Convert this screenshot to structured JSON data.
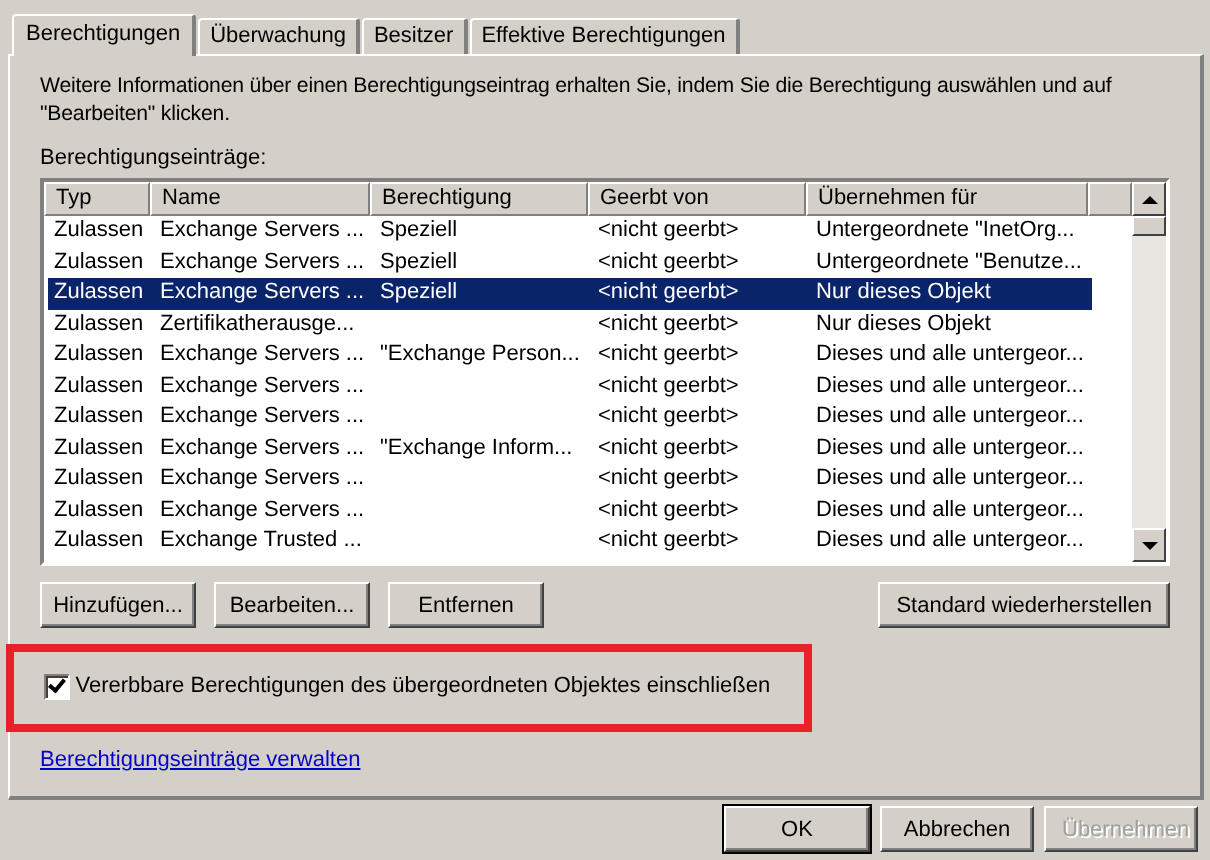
{
  "tabs": [
    {
      "label": "Berechtigungen",
      "selected": true
    },
    {
      "label": "Überwachung",
      "selected": false
    },
    {
      "label": "Besitzer",
      "selected": false
    },
    {
      "label": "Effektive Berechtigungen",
      "selected": false
    }
  ],
  "info_text": "Weitere Informationen über einen Berechtigungseintrag erhalten Sie, indem Sie die Berechtigung auswählen und auf \"Bearbeiten\" klicken.",
  "list_label": "Berechtigungseinträge:",
  "table": {
    "columns": [
      "Typ",
      "Name",
      "Berechtigung",
      "Geerbt von",
      "Übernehmen für"
    ],
    "rows": [
      {
        "cells": [
          "Zulassen",
          "Exchange Servers ...",
          "Speziell",
          "<nicht geerbt>",
          "Untergeordnete \"InetOrg..."
        ],
        "selected": false
      },
      {
        "cells": [
          "Zulassen",
          "Exchange Servers ...",
          "Speziell",
          "<nicht geerbt>",
          "Untergeordnete \"Benutze..."
        ],
        "selected": false
      },
      {
        "cells": [
          "Zulassen",
          "Exchange Servers ...",
          "Speziell",
          "<nicht geerbt>",
          "Nur dieses Objekt"
        ],
        "selected": true
      },
      {
        "cells": [
          "Zulassen",
          "Zertifikatherausge...",
          "",
          "<nicht geerbt>",
          "Nur dieses Objekt"
        ],
        "selected": false
      },
      {
        "cells": [
          "Zulassen",
          "Exchange Servers ...",
          "\"Exchange Person...",
          "<nicht geerbt>",
          "Dieses und alle untergeor..."
        ],
        "selected": false
      },
      {
        "cells": [
          "Zulassen",
          "Exchange Servers ...",
          "",
          "<nicht geerbt>",
          "Dieses und alle untergeor..."
        ],
        "selected": false
      },
      {
        "cells": [
          "Zulassen",
          "Exchange Servers ...",
          "",
          "<nicht geerbt>",
          "Dieses und alle untergeor..."
        ],
        "selected": false
      },
      {
        "cells": [
          "Zulassen",
          "Exchange Servers ...",
          "\"Exchange Inform...",
          "<nicht geerbt>",
          "Dieses und alle untergeor..."
        ],
        "selected": false
      },
      {
        "cells": [
          "Zulassen",
          "Exchange Servers ...",
          "",
          "<nicht geerbt>",
          "Dieses und alle untergeor..."
        ],
        "selected": false
      },
      {
        "cells": [
          "Zulassen",
          "Exchange Servers ...",
          "",
          "<nicht geerbt>",
          "Dieses und alle untergeor..."
        ],
        "selected": false
      },
      {
        "cells": [
          "Zulassen",
          "Exchange Trusted ...",
          "",
          "<nicht geerbt>",
          "Dieses und alle untergeor..."
        ],
        "selected": false
      }
    ]
  },
  "list_buttons": [
    "Hinzufügen...",
    "Bearbeiten...",
    "Entfernen"
  ],
  "restore_button": "Standard wiederherstellen",
  "inherit_checkbox": {
    "label": "Vererbbare Berechtigungen des übergeordneten Objektes einschließen",
    "checked": true
  },
  "manage_link": "Berechtigungseinträge verwalten",
  "dialog_buttons": [
    {
      "label": "OK",
      "disabled": false,
      "default": true
    },
    {
      "label": "Abbrechen",
      "disabled": false,
      "default": false
    },
    {
      "label": "Übernehmen",
      "disabled": true,
      "default": false
    }
  ]
}
